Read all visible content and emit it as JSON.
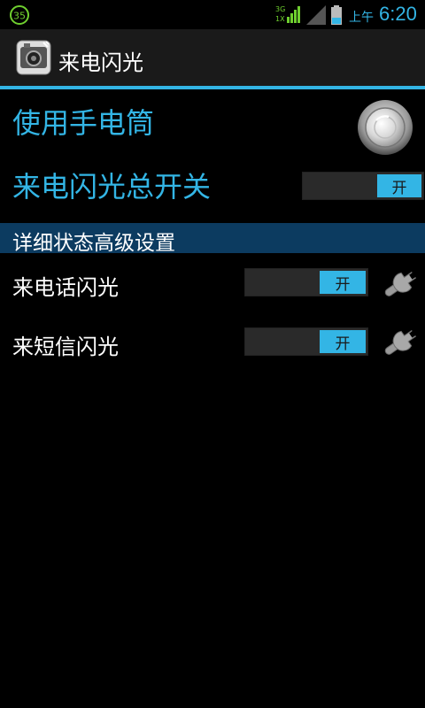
{
  "status_bar": {
    "notification_badge": "35",
    "network_top": "3G",
    "network_bottom": "1X",
    "ampm": "上午",
    "time": "6:20",
    "icons": [
      "notification-badge-icon",
      "data-network-icon",
      "signal-icon",
      "battery-icon"
    ]
  },
  "app": {
    "title": "来电闪光",
    "icon": "camera-flash-icon"
  },
  "flashlight": {
    "label": "使用手电筒",
    "icon": "flashlight-icon"
  },
  "master_switch": {
    "label": "来电闪光总开关",
    "state": "开"
  },
  "section": {
    "title": "详细状态高级设置"
  },
  "settings": [
    {
      "label": "来电话闪光",
      "state": "开",
      "icon": "wrench-icon"
    },
    {
      "label": "来短信闪光",
      "state": "开",
      "icon": "wrench-icon"
    }
  ],
  "colors": {
    "accent": "#33b5e5",
    "section_bg": "#0c3b60",
    "background": "#000000"
  }
}
